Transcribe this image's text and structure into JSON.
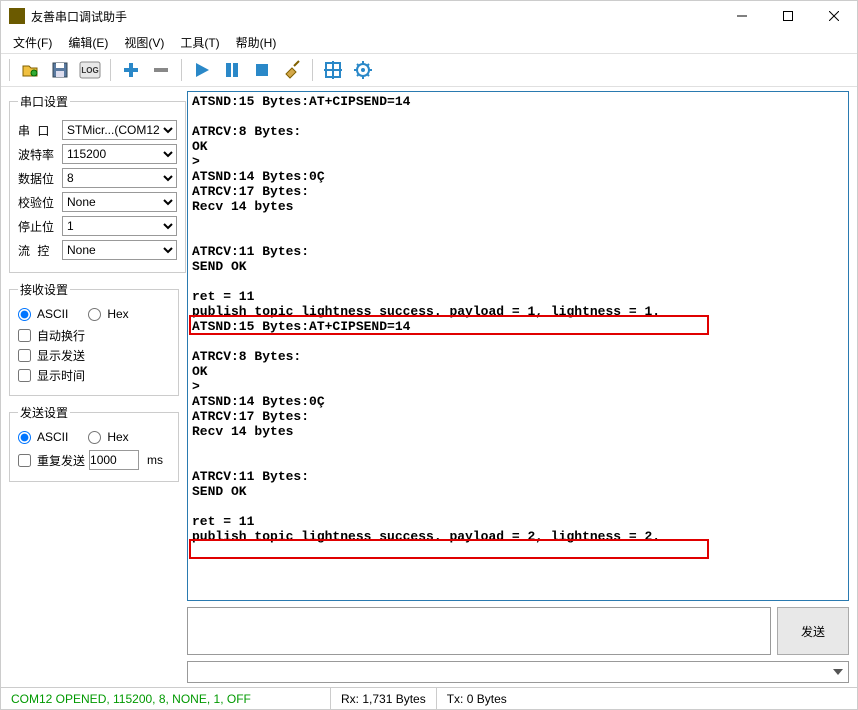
{
  "window": {
    "title": "友善串口调试助手"
  },
  "menu": {
    "file": "文件(F)",
    "edit": "编辑(E)",
    "view": "视图(V)",
    "tools": "工具(T)",
    "help": "帮助(H)"
  },
  "sidebar": {
    "serial_settings": {
      "legend": "串口设置",
      "port_label": "串  口",
      "port_value": "STMicr...(COM12",
      "baud_label": "波特率",
      "baud_value": "115200",
      "databits_label": "数据位",
      "databits_value": "8",
      "parity_label": "校验位",
      "parity_value": "None",
      "stopbits_label": "停止位",
      "stopbits_value": "1",
      "flow_label": "流  控",
      "flow_value": "None"
    },
    "recv_settings": {
      "legend": "接收设置",
      "ascii": "ASCII",
      "hex": "Hex",
      "auto_wrap": "自动换行",
      "show_send": "显示发送",
      "show_time": "显示时间"
    },
    "send_settings": {
      "legend": "发送设置",
      "ascii": "ASCII",
      "hex": "Hex",
      "repeat": "重复发送",
      "repeat_ms": "1000",
      "ms_unit": "ms"
    }
  },
  "console_text": "ATSND:15 Bytes:AT+CIPSEND=14\n\nATRCV:8 Bytes:\nOK\n>\nATSND:14 Bytes:0Ç\nATRCV:17 Bytes:\nRecv 14 bytes\n\n\nATRCV:11 Bytes:\nSEND OK\n\nret = 11\npublish topic lightness success. payload = 1, lightness = 1.\nATSND:15 Bytes:AT+CIPSEND=14\n\nATRCV:8 Bytes:\nOK\n>\nATSND:14 Bytes:0Ç\nATRCV:17 Bytes:\nRecv 14 bytes\n\n\nATRCV:11 Bytes:\nSEND OK\n\nret = 11\npublish topic lightness success. payload = 2, lightness = 2.\n",
  "send": {
    "button": "发送",
    "input_value": ""
  },
  "status": {
    "conn": "COM12 OPENED, 115200, 8, NONE, 1, OFF",
    "rx": "Rx: 1,731 Bytes",
    "tx": "Tx: 0 Bytes"
  }
}
